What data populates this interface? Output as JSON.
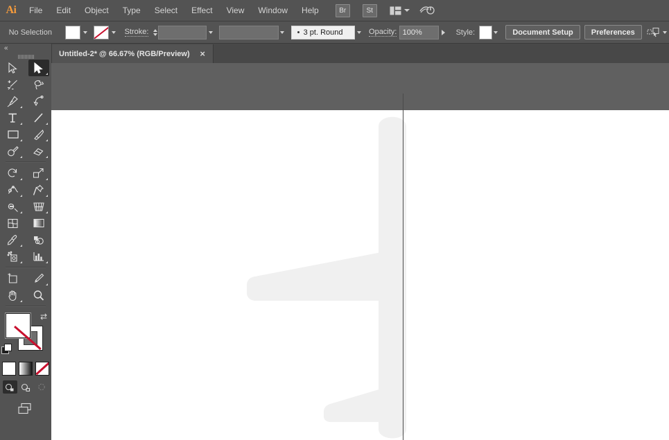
{
  "app": {
    "name": "Adobe Illustrator",
    "logo_text": "Ai",
    "logo_color": "#f59b3c"
  },
  "menubar": {
    "items": [
      {
        "label": "File"
      },
      {
        "label": "Edit"
      },
      {
        "label": "Object"
      },
      {
        "label": "Type"
      },
      {
        "label": "Select"
      },
      {
        "label": "Effect"
      },
      {
        "label": "View"
      },
      {
        "label": "Window"
      },
      {
        "label": "Help"
      }
    ],
    "right_buttons": [
      {
        "label": "Br",
        "name": "bridge-button"
      },
      {
        "label": "St",
        "name": "stock-button"
      }
    ],
    "arrange_documents_icon": "arrange-documents-icon",
    "workspace_switcher_icon": "workspace-switcher-icon"
  },
  "controlbar": {
    "selection_status": "No Selection",
    "fill_swatch": {
      "name": "fill-swatch",
      "color": "#ffffff"
    },
    "stroke_swatch": {
      "name": "stroke-swatch",
      "color": "none"
    },
    "stroke_label": "Stroke:",
    "stroke_weight_value": "",
    "variable_width_value": "",
    "brush_definition": "3 pt. Round",
    "opacity_label": "Opacity:",
    "opacity_value": "100%",
    "style_label": "Style:",
    "style_swatch_color": "#ffffff",
    "document_setup_label": "Document Setup",
    "preferences_label": "Preferences",
    "select_similar_icon": "select-similar-objects-icon"
  },
  "tabbar": {
    "tabs": [
      {
        "title": "Untitled-2* @ 66.67% (RGB/Preview)",
        "close_label": "×",
        "active": true
      }
    ]
  },
  "toolbar": {
    "collapse_label": "«",
    "tools": [
      {
        "name": "selection-tool",
        "label": "Selection",
        "active": false,
        "corner": false
      },
      {
        "name": "direct-selection-tool",
        "label": "Direct Selection",
        "active": true,
        "corner": true
      },
      {
        "name": "magic-wand-tool",
        "label": "Magic Wand",
        "active": false,
        "corner": false
      },
      {
        "name": "lasso-tool",
        "label": "Lasso",
        "active": false,
        "corner": false
      },
      {
        "name": "pen-tool",
        "label": "Pen",
        "active": false,
        "corner": true
      },
      {
        "name": "curvature-tool",
        "label": "Curvature",
        "active": false,
        "corner": false
      },
      {
        "name": "type-tool",
        "label": "Type",
        "active": false,
        "corner": true
      },
      {
        "name": "line-segment-tool",
        "label": "Line Segment",
        "active": false,
        "corner": true
      },
      {
        "name": "rectangle-tool",
        "label": "Rectangle",
        "active": false,
        "corner": true
      },
      {
        "name": "paintbrush-tool",
        "label": "Paintbrush",
        "active": false,
        "corner": true
      },
      {
        "name": "shaper-tool",
        "label": "Shaper",
        "active": false,
        "corner": true
      },
      {
        "name": "eraser-tool",
        "label": "Eraser",
        "active": false,
        "corner": true
      },
      {
        "name": "rotate-tool",
        "label": "Rotate",
        "active": false,
        "corner": true
      },
      {
        "name": "scale-tool",
        "label": "Scale",
        "active": false,
        "corner": true
      },
      {
        "name": "width-tool",
        "label": "Width",
        "active": false,
        "corner": true
      },
      {
        "name": "free-transform-tool",
        "label": "Free Transform",
        "active": false,
        "corner": true
      },
      {
        "name": "shape-builder-tool",
        "label": "Shape Builder",
        "active": false,
        "corner": true
      },
      {
        "name": "perspective-grid-tool",
        "label": "Perspective Grid",
        "active": false,
        "corner": true
      },
      {
        "name": "mesh-tool",
        "label": "Mesh",
        "active": false,
        "corner": false
      },
      {
        "name": "gradient-tool",
        "label": "Gradient",
        "active": false,
        "corner": false
      },
      {
        "name": "eyedropper-tool",
        "label": "Eyedropper",
        "active": false,
        "corner": true
      },
      {
        "name": "blend-tool",
        "label": "Blend",
        "active": false,
        "corner": false
      },
      {
        "name": "symbol-sprayer-tool",
        "label": "Symbol Sprayer",
        "active": false,
        "corner": true
      },
      {
        "name": "column-graph-tool",
        "label": "Column Graph",
        "active": false,
        "corner": true
      },
      {
        "name": "artboard-tool",
        "label": "Artboard",
        "active": false,
        "corner": false
      },
      {
        "name": "slice-tool",
        "label": "Slice",
        "active": false,
        "corner": true
      },
      {
        "name": "hand-tool",
        "label": "Hand",
        "active": false,
        "corner": true
      },
      {
        "name": "zoom-tool",
        "label": "Zoom",
        "active": false,
        "corner": false
      }
    ],
    "fill_stroke": {
      "fill_color": "#ffffff",
      "stroke_color": "none",
      "swap_icon": "swap-fill-stroke-icon",
      "default_icon": "default-fill-stroke-icon"
    },
    "color_modes": [
      {
        "name": "color-mode-button",
        "label": "Color"
      },
      {
        "name": "gradient-mode-button",
        "label": "Gradient"
      },
      {
        "name": "none-mode-button",
        "label": "None"
      }
    ],
    "drawing_modes": [
      {
        "name": "draw-normal-button",
        "label": "Draw Normal",
        "active": true
      },
      {
        "name": "draw-behind-button",
        "label": "Draw Behind",
        "active": false
      },
      {
        "name": "draw-inside-button",
        "label": "Draw Inside",
        "active": false
      }
    ],
    "screen_mode": {
      "name": "change-screen-mode-button",
      "label": "Change Screen Mode"
    }
  },
  "canvas": {
    "background_color": "#606060",
    "artboard_color": "#ffffff",
    "artwork": {
      "name": "airplane-silhouette",
      "fill_color": "#f0f0f0"
    },
    "guide": {
      "name": "vertical-guide",
      "color": "#4a4a4a"
    }
  }
}
